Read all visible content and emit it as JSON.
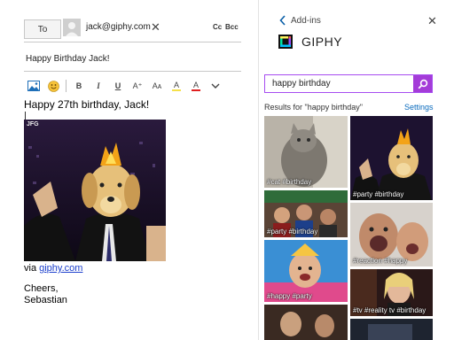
{
  "compose": {
    "to_label": "To",
    "recipient": "jack@giphy.com",
    "remove_glyph": "✕",
    "cc_label": "Cc",
    "bcc_label": "Bcc",
    "subject": "Happy Birthday Jack!",
    "toolbar": {
      "bold": "B",
      "italic": "I",
      "underline": "U",
      "grow_font": "A⁺",
      "shrink_font": "Aᴀ",
      "highlight": "A",
      "font_color": "A",
      "more": "⌄"
    },
    "body_line": "Happy 27th birthday, Jack!",
    "gif_watermark": "JFG",
    "via_text": "via ",
    "via_link": "giphy.com",
    "signoff": "Cheers,",
    "signature": "Sebastian"
  },
  "addin": {
    "back_glyph": "<",
    "header": "Add-ins",
    "close_glyph": "✕",
    "app_name": "GIPHY",
    "search_value": "happy birthday",
    "results_label": "Results for \"happy birthday\"",
    "settings_label": "Settings",
    "tiles": [
      {
        "tags": "#cat #birthday"
      },
      {
        "tags": "#party #birthday"
      },
      {
        "tags": "#party #birthday"
      },
      {
        "tags": "#reaction #happy"
      },
      {
        "tags": "#happy #party"
      },
      {
        "tags": "#tv #reality tv #birthday"
      },
      {
        "tags": ""
      },
      {
        "tags": ""
      }
    ]
  },
  "colors": {
    "giphy_accent": "#a43cd8",
    "link": "#1a3ecc"
  }
}
